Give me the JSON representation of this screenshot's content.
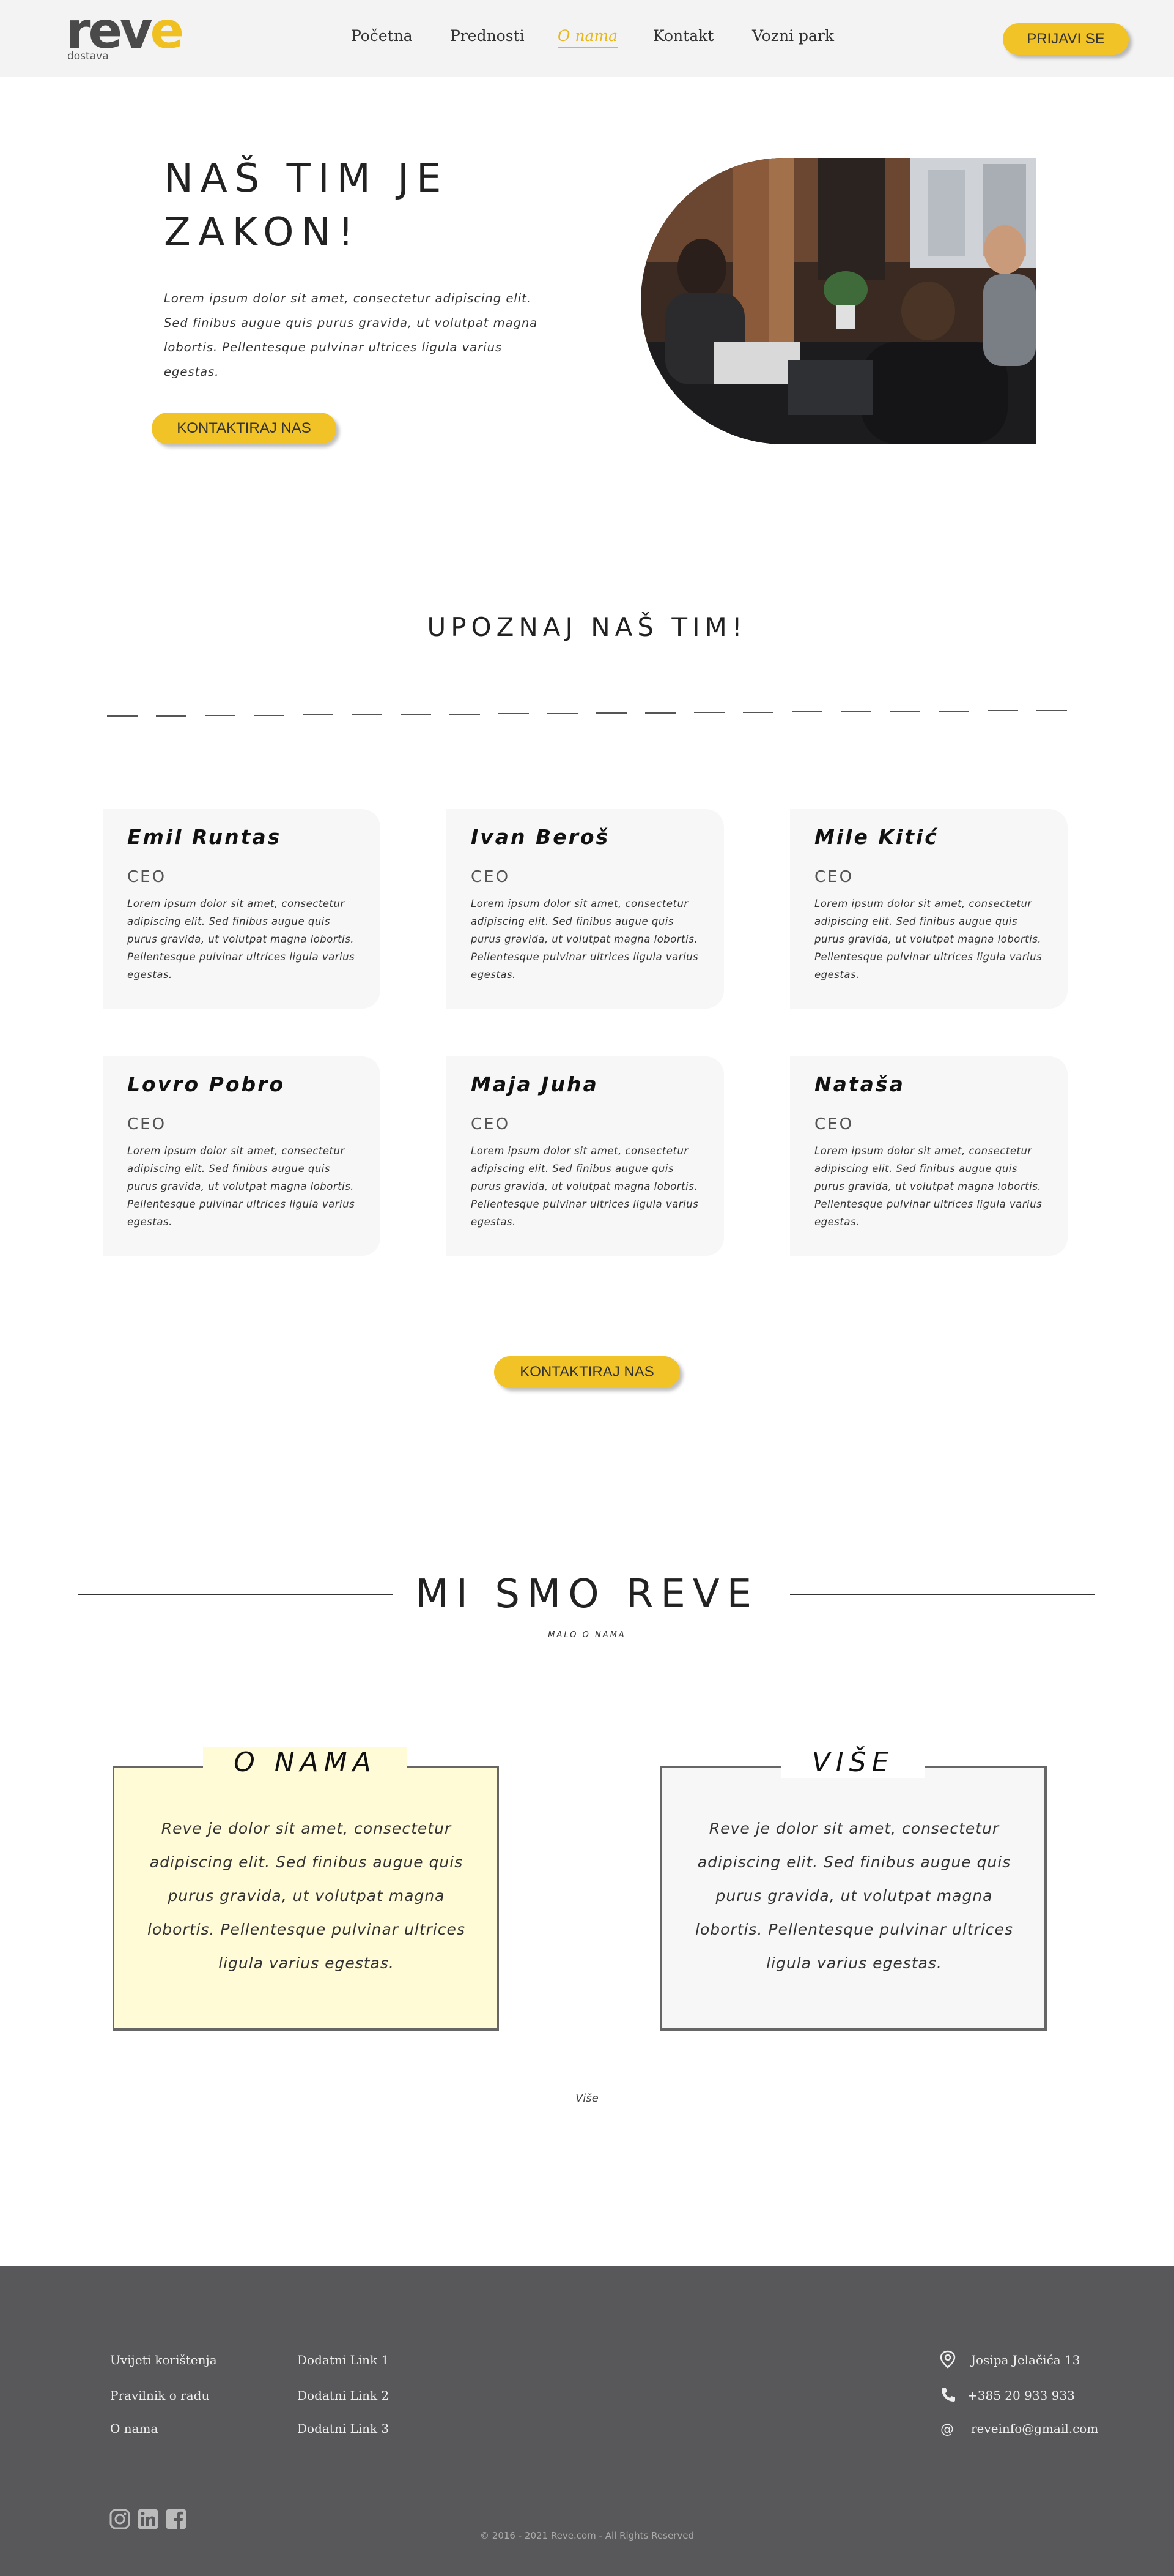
{
  "brand": {
    "logo_text_1": "rev",
    "logo_text_2": "e",
    "logo_sub": "dostava",
    "accent": "#f2c326"
  },
  "nav": {
    "items": [
      {
        "label": "Početna"
      },
      {
        "label": "Prednosti"
      },
      {
        "label": "O nama"
      },
      {
        "label": "Kontakt"
      },
      {
        "label": "Vozni park"
      }
    ],
    "active": "O nama",
    "login_label": "PRIJAVI SE"
  },
  "hero": {
    "title": "NAŠ TIM JE ZAKON!",
    "text": "Lorem ipsum dolor sit amet, consectetur adipiscing elit. Sed finibus augue quis purus gravida, ut volutpat magna lobortis. Pellentesque pulvinar ultrices ligula varius egestas.",
    "button": "KONTAKTIRAJ NAS"
  },
  "team": {
    "title": "UPOZNAJ NAŠ TIM!",
    "members": [
      {
        "name": "Emil Runtas",
        "role": "CEO",
        "text": "Lorem ipsum dolor sit amet, consectetur adipiscing elit. Sed finibus augue quis purus gravida, ut volutpat magna lobortis. Pellentesque pulvinar ultrices ligula varius egestas."
      },
      {
        "name": "Ivan Beroš",
        "role": "CEO",
        "text": "Lorem ipsum dolor sit amet, consectetur adipiscing elit. Sed finibus augue quis purus gravida, ut volutpat magna lobortis. Pellentesque pulvinar ultrices ligula varius egestas."
      },
      {
        "name": "Mile Kitić",
        "role": "CEO",
        "text": "Lorem ipsum dolor sit amet, consectetur adipiscing elit. Sed finibus augue quis purus gravida, ut volutpat magna lobortis. Pellentesque pulvinar ultrices ligula varius egestas."
      },
      {
        "name": "Lovro Pobro",
        "role": "CEO",
        "text": "Lorem ipsum dolor sit amet, consectetur adipiscing elit. Sed finibus augue quis purus gravida, ut volutpat magna lobortis. Pellentesque pulvinar ultrices ligula varius egestas."
      },
      {
        "name": "Maja Juha",
        "role": "CEO",
        "text": "Lorem ipsum dolor sit amet, consectetur adipiscing elit. Sed finibus augue quis purus gravida, ut volutpat magna lobortis. Pellentesque pulvinar ultrices ligula varius egestas."
      },
      {
        "name": "Nataša",
        "role": "CEO",
        "text": "Lorem ipsum dolor sit amet, consectetur adipiscing elit. Sed finibus augue quis purus gravida, ut volutpat magna lobortis. Pellentesque pulvinar ultrices ligula varius egestas."
      }
    ],
    "button": "KONTAKTIRAJ NAS"
  },
  "about": {
    "title": "MI SMO REVE",
    "subtitle": "MALO O NAMA",
    "boxes": [
      {
        "title": "O NAMA",
        "text": "Reve je dolor sit amet, consectetur adipiscing elit. Sed finibus augue quis purus gravida, ut volutpat magna lobortis. Pellentesque pulvinar ultrices ligula varius egestas."
      },
      {
        "title": "VIŠE",
        "text": "Reve je dolor sit amet, consectetur adipiscing elit. Sed finibus augue quis purus gravida, ut volutpat magna lobortis. Pellentesque pulvinar ultrices ligula varius egestas."
      }
    ],
    "more_link": "Više"
  },
  "footer": {
    "links_col1": [
      "Uvijeti korištenja",
      "Pravilnik o radu",
      "O nama"
    ],
    "links_col2": [
      "Dodatni Link 1",
      "Dodatni Link 2",
      "Dodatni Link 3"
    ],
    "contact": {
      "address": "Josipa Jelačića 13",
      "phone": "+385 20 933 933",
      "email": "reveinfo@gmail.com"
    },
    "social_icons": [
      "instagram-icon",
      "linkedin-icon",
      "facebook-icon"
    ],
    "copyright": "© 2016 - 2021 Reve.com - All Rights Reserved"
  }
}
